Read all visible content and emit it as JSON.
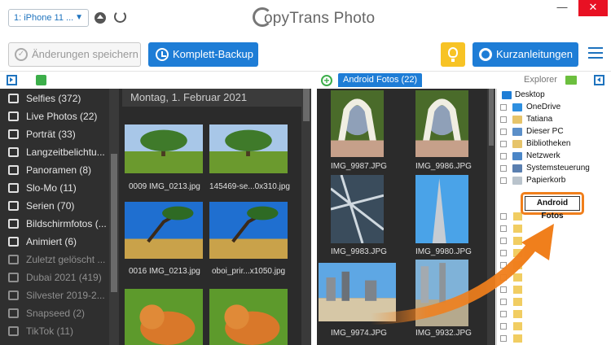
{
  "titlebar": {
    "device": "1: iPhone 11 ...",
    "app_title": "opyTrans Photo",
    "minimize": "—",
    "close": "✕"
  },
  "toolbar": {
    "save_label": "Änderungen speichern",
    "backup_label": "Komplett-Backup",
    "guides_label": "Kurzanleitungen"
  },
  "header": {
    "android_tab": "Android Fotos (22)",
    "explorer_label": "Explorer"
  },
  "sidebar": {
    "albums": [
      {
        "label": "Selfies (372)",
        "dim": false
      },
      {
        "label": "Live Photos (22)",
        "dim": false
      },
      {
        "label": "Porträt (33)",
        "dim": false
      },
      {
        "label": "Langzeitbelichtu...",
        "dim": false
      },
      {
        "label": "Panoramen (8)",
        "dim": false
      },
      {
        "label": "Slo-Mo (11)",
        "dim": false
      },
      {
        "label": "Serien (70)",
        "dim": false
      },
      {
        "label": "Bildschirmfotos (...",
        "dim": false
      },
      {
        "label": "Animiert (6)",
        "dim": false
      },
      {
        "label": "Zuletzt gelöscht ...",
        "dim": true
      },
      {
        "label": "Dubai 2021 (419)",
        "dim": true
      },
      {
        "label": "Silvester 2019-2...",
        "dim": true
      },
      {
        "label": "Snapseed (2)",
        "dim": true
      },
      {
        "label": "TikTok (11)",
        "dim": true
      }
    ]
  },
  "grid": {
    "date": "Montag, 1. Februar 2021",
    "captions": [
      "0009 IMG_0213.jpg",
      "145469-se...0x310.jpg",
      "0016 IMG_0213.jpg",
      "oboi_prir...x1050.jpg"
    ]
  },
  "android": {
    "captions": [
      "IMG_9987.JPG",
      "IMG_9986.JPG",
      "IMG_9983.JPG",
      "IMG_9980.JPG",
      "IMG_9974.JPG",
      "IMG_9932.JPG"
    ]
  },
  "explorer": {
    "items": [
      "Desktop",
      "OneDrive",
      "Tatiana",
      "Dieser PC",
      "Bibliotheken",
      "Netzwerk",
      "Systemsteuerung",
      "Papierkorb"
    ],
    "drop_target": "Android Fotos"
  },
  "colors": {
    "accent": "#1e7dd6",
    "dark_panel": "#2f2f2f",
    "arrow": "#f07f1c",
    "bulb": "#f7c325"
  }
}
